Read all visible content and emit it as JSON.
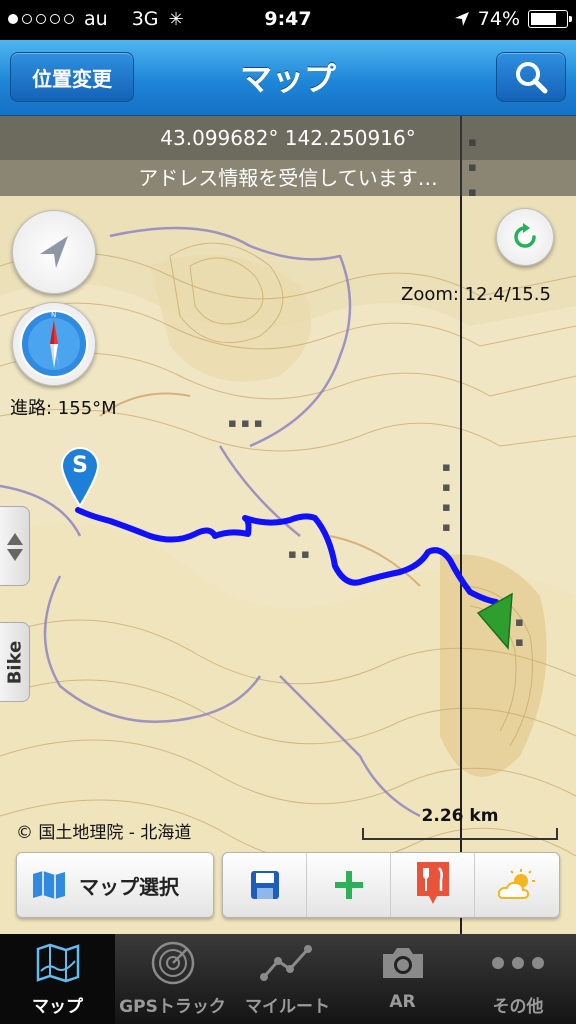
{
  "status_bar": {
    "carrier": "au",
    "network": "3G",
    "time": "9:47",
    "battery": "74%",
    "battery_level": 0.74,
    "signal_strength": 1
  },
  "nav_bar": {
    "left_button": "位置変更",
    "title": "マップ",
    "right_icon": "search-icon"
  },
  "map": {
    "coordinates": "43.099682° 142.250916°",
    "address_status": "アドレス情報を受信しています…",
    "zoom": "Zoom: 12.4/15.5",
    "heading": "進路: 155°M",
    "start_marker": "S",
    "side_tab_label": "Bike",
    "copyright": "© 国土地理院 - 北海道",
    "scale": "2.26 km"
  },
  "toolbar": {
    "map_select_label": "マップ選択",
    "buttons": [
      "save-icon",
      "add-icon",
      "restaurant-icon",
      "weather-icon"
    ]
  },
  "tab_bar": {
    "tabs": [
      {
        "label": "マップ",
        "icon": "map-icon",
        "active": true
      },
      {
        "label": "GPSトラック",
        "icon": "radar-icon",
        "active": false
      },
      {
        "label": "マイルート",
        "icon": "route-icon",
        "active": false
      },
      {
        "label": "AR",
        "icon": "camera-icon",
        "active": false
      },
      {
        "label": "その他",
        "icon": "more-icon",
        "active": false
      }
    ]
  },
  "colors": {
    "nav_blue": "#1f86d8",
    "track_blue": "#1010ff",
    "marker_green": "#2e9e2e",
    "map_beige": "#f0e6c4"
  }
}
